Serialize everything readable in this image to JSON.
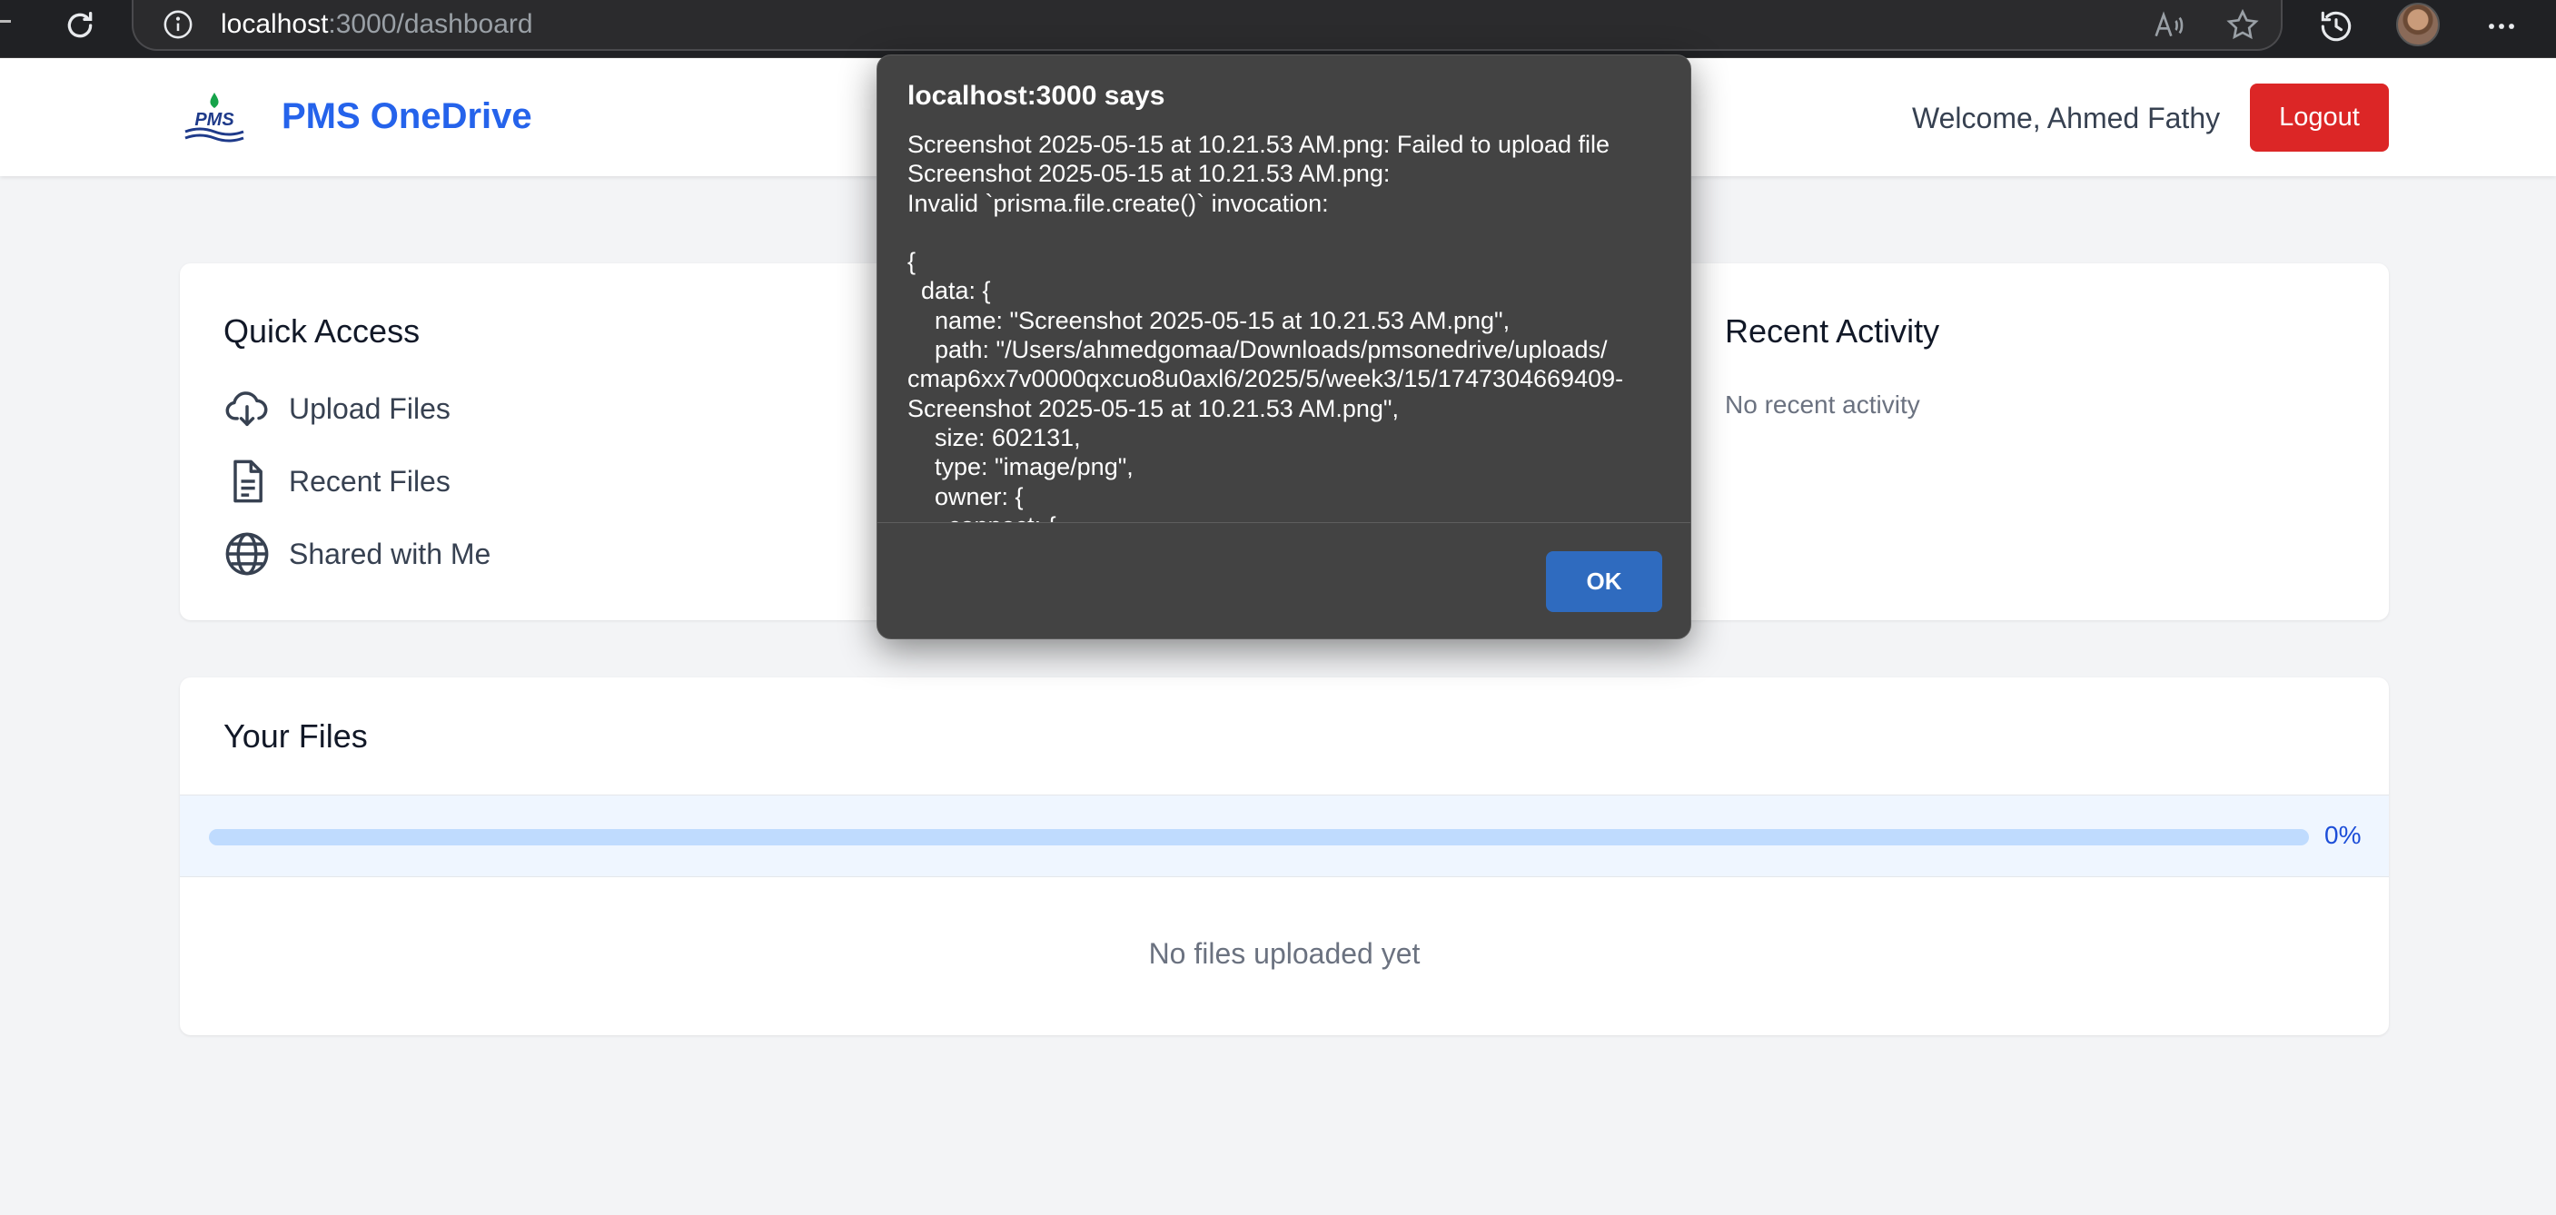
{
  "browser": {
    "url_host": "localhost",
    "url_rest": ":3000/dashboard"
  },
  "header": {
    "brand": "PMS OneDrive",
    "logo_text": "PMS",
    "welcome": "Welcome, Ahmed Fathy",
    "logout_label": "Logout"
  },
  "quick_access": {
    "title": "Quick Access",
    "items": [
      {
        "label": "Upload Files",
        "icon": "cloud-download-icon"
      },
      {
        "label": "Recent Files",
        "icon": "document-icon"
      },
      {
        "label": "Shared with Me",
        "icon": "globe-icon"
      }
    ]
  },
  "recent_activity": {
    "title": "Recent Activity",
    "empty": "No recent activity"
  },
  "files": {
    "title": "Your Files",
    "progress": 0,
    "progress_label": "0%",
    "empty": "No files uploaded yet"
  },
  "dialog": {
    "title": "localhost:3000 says",
    "message": "Screenshot 2025-05-15 at 10.21.53 AM.png: Failed to upload file\nScreenshot 2025-05-15 at 10.21.53 AM.png:\nInvalid `prisma.file.create()` invocation:\n\n{\n  data: {\n    name: \"Screenshot 2025-05-15 at 10.21.53 AM.png\",\n    path: \"/Users/ahmedgomaa/Downloads/pmsonedrive/uploads/\ncmap6xx7v0000qxcuo8u0axl6/2025/5/week3/15/1747304669409-\nScreenshot 2025-05-15 at 10.21.53 AM.png\",\n    size: 602131,\n    type: \"image/png\",\n    owner: {\n      connect: {",
    "ok_label": "OK"
  },
  "colors": {
    "brand": "#2563eb",
    "logout": "#dc2626",
    "dialog_bg": "#434343",
    "ok_button": "#2f6bbf"
  }
}
